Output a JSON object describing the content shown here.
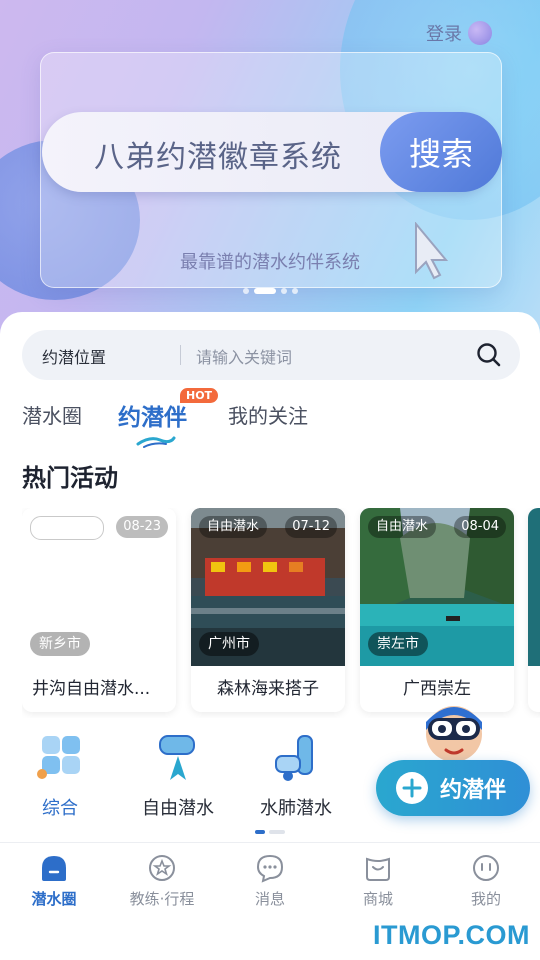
{
  "header": {
    "login_label": "登录"
  },
  "banner": {
    "title": "八弟约潜徽章系统",
    "search_label": "搜索",
    "tagline": "最靠谱的潜水约伴系统",
    "active_slide": 2,
    "slide_count": 4
  },
  "search": {
    "location_label": "约潜位置",
    "placeholder": "请输入关键词"
  },
  "tabs": [
    {
      "label": "潜水圈"
    },
    {
      "label": "约潜伴",
      "badge": "HOT",
      "active": true
    },
    {
      "label": "我的关注"
    }
  ],
  "section_title": "热门活动",
  "activities": [
    {
      "tag": "",
      "date": "08-23",
      "city": "新乡市",
      "title": "井沟自由潜水..."
    },
    {
      "tag": "自由潜水",
      "date": "07-12",
      "city": "广州市",
      "title": "森林海来搭子"
    },
    {
      "tag": "自由潜水",
      "date": "08-04",
      "city": "崇左市",
      "title": "广西崇左"
    }
  ],
  "categories": [
    {
      "label": "综合",
      "icon": "grid-icon",
      "active": true
    },
    {
      "label": "自由潜水",
      "icon": "diving-mask-icon"
    },
    {
      "label": "水肺潜水",
      "icon": "scuba-tank-icon"
    }
  ],
  "fab": {
    "label": "约潜伴"
  },
  "bottom_nav": [
    {
      "label": "潜水圈",
      "icon": "dive-circle-icon",
      "active": true
    },
    {
      "label": "教练·行程",
      "icon": "coach-icon"
    },
    {
      "label": "消息",
      "icon": "message-icon"
    },
    {
      "label": "商城",
      "icon": "shop-icon"
    },
    {
      "label": "我的",
      "icon": "profile-icon"
    }
  ],
  "watermark": "ITMOP.COM",
  "colors": {
    "accent": "#2d6ec9",
    "hot": "#f36a3c",
    "fab": "#2aa7cf",
    "watermark": "#2a9ad2"
  }
}
